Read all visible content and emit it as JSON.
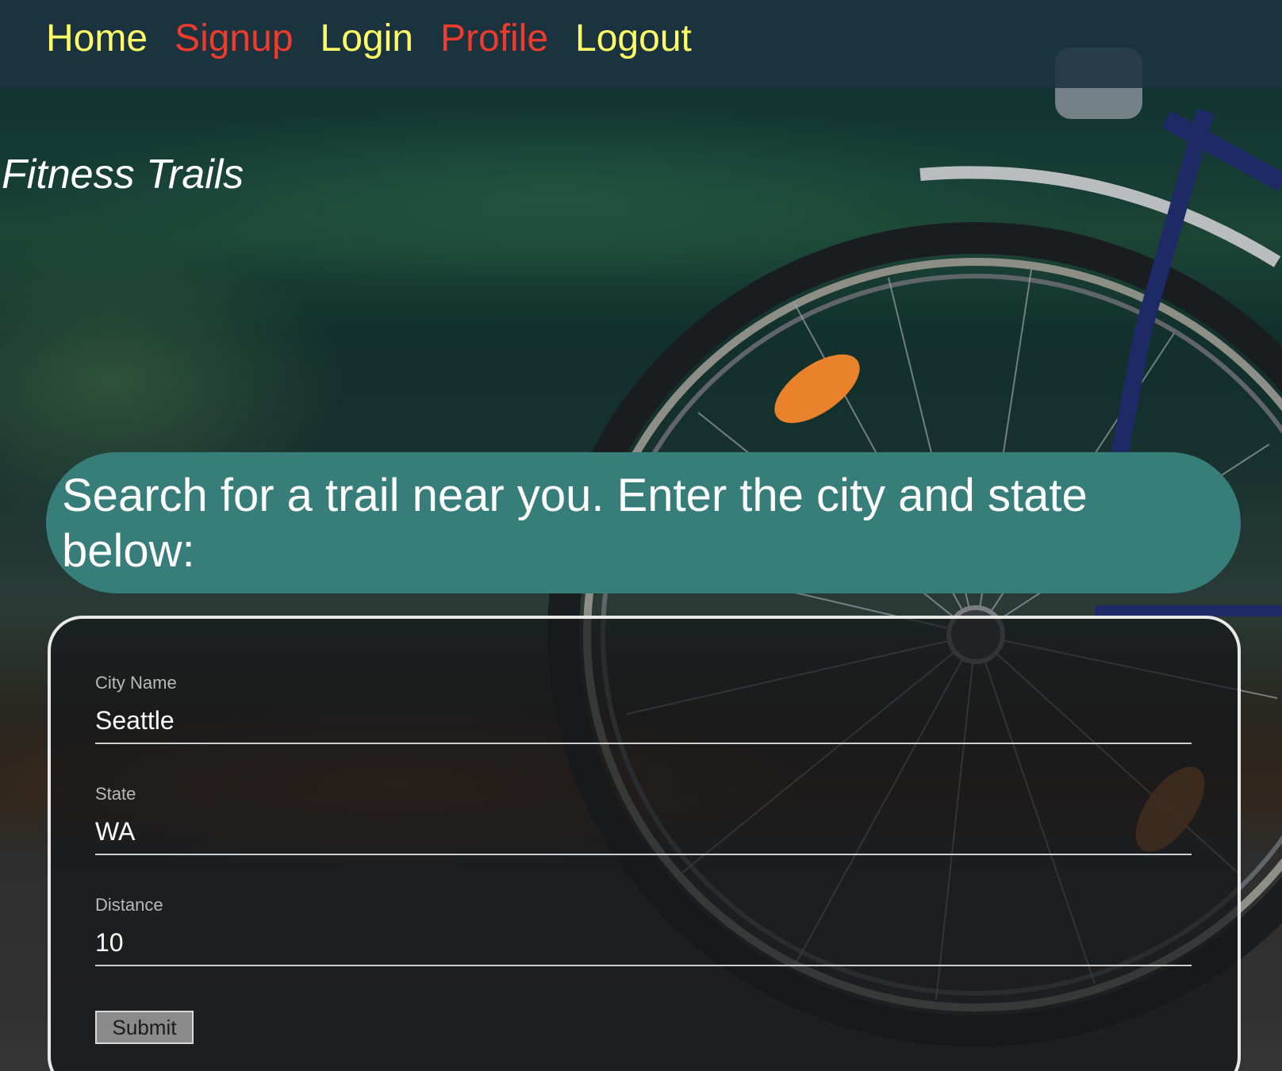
{
  "nav": {
    "items": [
      {
        "label": "Home",
        "color": "#fefe66"
      },
      {
        "label": "Signup",
        "color": "#ef3b2c"
      },
      {
        "label": "Login",
        "color": "#fefe66"
      },
      {
        "label": "Profile",
        "color": "#ef3b2c"
      },
      {
        "label": "Logout",
        "color": "#fefe66"
      }
    ]
  },
  "header": {
    "title": "Fitness Trails"
  },
  "search": {
    "prompt": "Search for a trail near you. Enter the city and state below:",
    "fields": [
      {
        "label": "City Name",
        "value": "Seattle"
      },
      {
        "label": "State",
        "value": "WA"
      },
      {
        "label": "Distance",
        "value": "10"
      }
    ],
    "submit_label": "Submit"
  },
  "colors": {
    "nav_background": "#1c3442",
    "prompt_background": "#377e7b",
    "card_border": "#e8e8e8"
  }
}
